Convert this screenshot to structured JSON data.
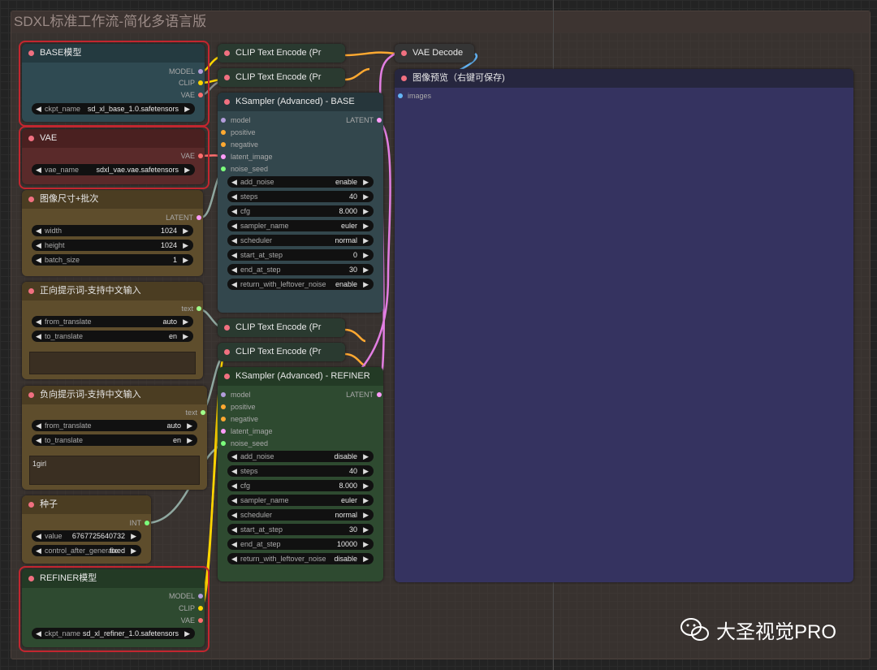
{
  "group": {
    "title": "SDXL标准工作流-简化多语言版"
  },
  "nodes": {
    "base_model": {
      "title": "BASE模型",
      "outputs": [
        "MODEL",
        "CLIP",
        "VAE"
      ],
      "ckpt_label": "ckpt_name",
      "ckpt_value": "sd_xl_base_1.0.safetensors"
    },
    "vae": {
      "title": "VAE",
      "output": "VAE",
      "label": "vae_name",
      "value": "sdxl_vae.vae.safetensors"
    },
    "size": {
      "title": "图像尺寸+批次",
      "output": "LATENT",
      "widgets": [
        {
          "label": "width",
          "value": "1024"
        },
        {
          "label": "height",
          "value": "1024"
        },
        {
          "label": "batch_size",
          "value": "1"
        }
      ]
    },
    "pos_prompt": {
      "title": "正向提示词-支持中文输入",
      "output": "text",
      "widgets": [
        {
          "label": "from_translate",
          "value": "auto"
        },
        {
          "label": "to_translate",
          "value": "en"
        }
      ],
      "text": ""
    },
    "neg_prompt": {
      "title": "负向提示词-支持中文输入",
      "output": "text",
      "widgets": [
        {
          "label": "from_translate",
          "value": "auto"
        },
        {
          "label": "to_translate",
          "value": "en"
        }
      ],
      "text": "1girl"
    },
    "seed": {
      "title": "种子",
      "output": "INT",
      "widgets": [
        {
          "label": "value",
          "value": "6767725640732"
        },
        {
          "label": "control_after_generate",
          "value": "fixed"
        }
      ]
    },
    "refiner_model": {
      "title": "REFINER模型",
      "outputs": [
        "MODEL",
        "CLIP",
        "VAE"
      ],
      "ckpt_label": "ckpt_name",
      "ckpt_value": "sd_xl_refiner_1.0.safetensors"
    },
    "clip1": {
      "title": "CLIP Text Encode (Pr"
    },
    "clip2": {
      "title": "CLIP Text Encode (Pr"
    },
    "clip3": {
      "title": "CLIP Text Encode (Pr"
    },
    "clip4": {
      "title": "CLIP Text Encode (Pr"
    },
    "vae_decode": {
      "title": "VAE Decode"
    },
    "preview": {
      "title": "图像预览（右键可保存)",
      "input": "images"
    },
    "ks_base": {
      "title": "KSampler (Advanced) - BASE",
      "output": "LATENT",
      "inputs": [
        "model",
        "positive",
        "negative",
        "latent_image",
        "noise_seed"
      ],
      "widgets": [
        {
          "label": "add_noise",
          "value": "enable"
        },
        {
          "label": "steps",
          "value": "40"
        },
        {
          "label": "cfg",
          "value": "8.000"
        },
        {
          "label": "sampler_name",
          "value": "euler"
        },
        {
          "label": "scheduler",
          "value": "normal"
        },
        {
          "label": "start_at_step",
          "value": "0"
        },
        {
          "label": "end_at_step",
          "value": "30"
        },
        {
          "label": "return_with_leftover_noise",
          "value": "enable"
        }
      ]
    },
    "ks_refiner": {
      "title": "KSampler (Advanced) - REFINER",
      "output": "LATENT",
      "inputs": [
        "model",
        "positive",
        "negative",
        "latent_image",
        "noise_seed"
      ],
      "widgets": [
        {
          "label": "add_noise",
          "value": "disable"
        },
        {
          "label": "steps",
          "value": "40"
        },
        {
          "label": "cfg",
          "value": "8.000"
        },
        {
          "label": "sampler_name",
          "value": "euler"
        },
        {
          "label": "scheduler",
          "value": "normal"
        },
        {
          "label": "start_at_step",
          "value": "30"
        },
        {
          "label": "end_at_step",
          "value": "10000"
        },
        {
          "label": "return_with_leftover_noise",
          "value": "disable"
        }
      ]
    }
  },
  "watermark": "大圣视觉PRO",
  "colors": {
    "model": "#b39ddb",
    "clip": "#ffd500",
    "vae": "#ff6e6e",
    "latent": "#ff9cf9",
    "int": "#7cff7c",
    "conditioning": "#ffa931",
    "text": "#a1ff8a",
    "image": "#64b5f6",
    "link_latent": "#e27ee2",
    "link_int": "#8fa8a0"
  }
}
